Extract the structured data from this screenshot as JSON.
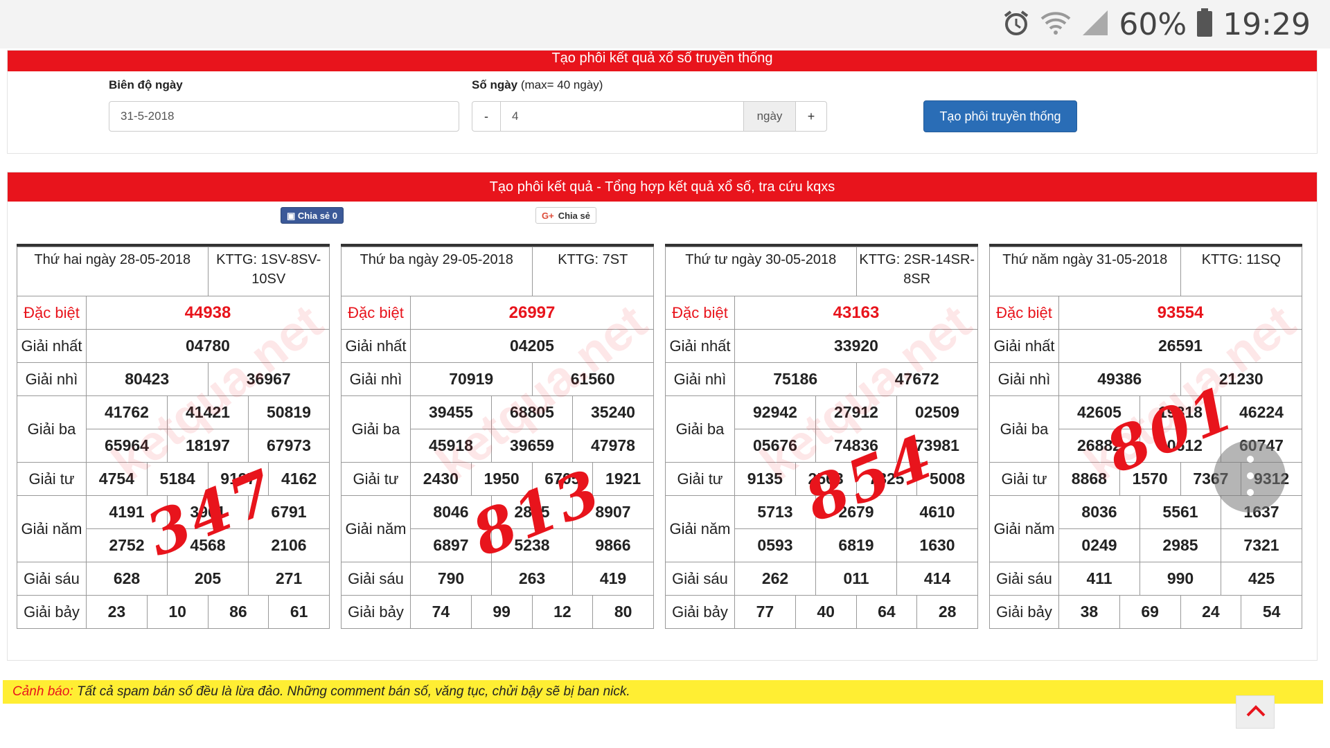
{
  "status": {
    "battery": "60%",
    "time": "19:29",
    "icons": [
      "alarm-icon",
      "wifi-icon",
      "signal-icon",
      "battery-icon"
    ]
  },
  "generator": {
    "title": "Tạo phôi kết quả xổ số truyền thống",
    "date_label": "Biên độ ngày",
    "date_value": "31-5-2018",
    "days_label": "Số ngày",
    "days_hint": "(max= 40 ngày)",
    "minus": "-",
    "days_value": "4",
    "days_unit": "ngày",
    "plus": "+",
    "submit": "Tạo phôi truyền thống"
  },
  "results": {
    "title": "Tạo phôi kết quả - Tổng hợp kết quả xổ số, tra cứu kqxs",
    "fb_share": "Chia sẻ",
    "fb_count": "0",
    "gplus_icon": "G+",
    "gplus_share": "Chia sẻ",
    "watermark": "ketqua.net",
    "labels": {
      "db": "Đặc biệt",
      "g1": "Giải nhất",
      "g2": "Giải nhì",
      "g3": "Giải ba",
      "g4": "Giải tư",
      "g5": "Giải năm",
      "g6": "Giải sáu",
      "g7": "Giải bảy"
    },
    "days": [
      {
        "date": "Thứ hai ngày 28-05-2018",
        "kttg": "KTTG: 1SV-8SV-10SV",
        "db": "44938",
        "g1": "04780",
        "g2": [
          "80423",
          "36967"
        ],
        "g3": [
          "41762",
          "41421",
          "50819",
          "65964",
          "18197",
          "67973"
        ],
        "g4": [
          "4754",
          "5184",
          "9197",
          "4162"
        ],
        "g5": [
          "4191",
          "3901",
          "6791",
          "2752",
          "4568",
          "2106"
        ],
        "g6": [
          "628",
          "205",
          "271"
        ],
        "g7": [
          "23",
          "10",
          "86",
          "61"
        ],
        "note": "347"
      },
      {
        "date": "Thứ ba ngày 29-05-2018",
        "kttg": "KTTG: 7ST",
        "db": "26997",
        "g1": "04205",
        "g2": [
          "70919",
          "61560"
        ],
        "g3": [
          "39455",
          "68805",
          "35240",
          "45918",
          "39659",
          "47978"
        ],
        "g4": [
          "2430",
          "1950",
          "6705",
          "1921"
        ],
        "g5": [
          "8046",
          "2885",
          "8907",
          "6897",
          "5238",
          "9866"
        ],
        "g6": [
          "790",
          "263",
          "419"
        ],
        "g7": [
          "74",
          "99",
          "12",
          "80"
        ],
        "note": "813"
      },
      {
        "date": "Thứ tư ngày 30-05-2018",
        "kttg": "KTTG: 2SR-14SR-8SR",
        "db": "43163",
        "g1": "33920",
        "g2": [
          "75186",
          "47672"
        ],
        "g3": [
          "92942",
          "27912",
          "02509",
          "05676",
          "74836",
          "73981"
        ],
        "g4": [
          "9135",
          "2563",
          "7825",
          "5008"
        ],
        "g5": [
          "5713",
          "2679",
          "4610",
          "0593",
          "6819",
          "1630"
        ],
        "g6": [
          "262",
          "011",
          "414"
        ],
        "g7": [
          "77",
          "40",
          "64",
          "28"
        ],
        "note": "854"
      },
      {
        "date": "Thứ năm ngày 31-05-2018",
        "kttg": "KTTG: 11SQ",
        "db": "93554",
        "g1": "26591",
        "g2": [
          "49386",
          "21230"
        ],
        "g3": [
          "42605",
          "19318",
          "46224",
          "26882",
          "80612",
          "60747"
        ],
        "g4": [
          "8868",
          "1570",
          "7367",
          "9312"
        ],
        "g5": [
          "8036",
          "5561",
          "1637",
          "0249",
          "2985",
          "7321"
        ],
        "g6": [
          "411",
          "990",
          "425"
        ],
        "g7": [
          "38",
          "69",
          "24",
          "54"
        ],
        "note": "801"
      }
    ]
  },
  "warning": {
    "label": "Cảnh báo:",
    "text": " Tất cả spam bán số đều là lừa đảo. Những comment bán số, văng tục, chửi bậy sẽ bị ban nick."
  }
}
